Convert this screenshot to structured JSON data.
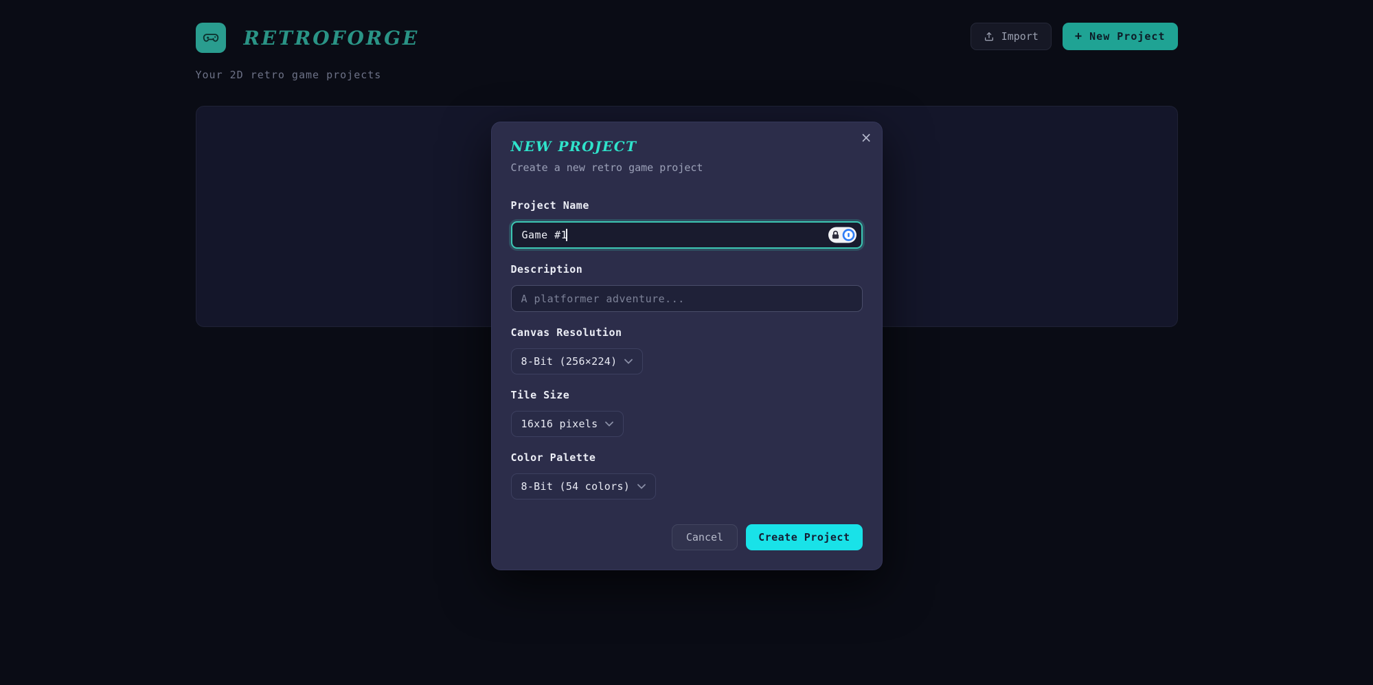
{
  "header": {
    "app_name": "RETROFORGE",
    "tagline": "Your 2D retro game projects",
    "import_label": "Import",
    "new_project_label": "New Project",
    "plus_glyph": "+"
  },
  "modal": {
    "title": "NEW PROJECT",
    "subtitle": "Create a new retro game project",
    "close_glyph": "×",
    "project_name": {
      "label": "Project Name",
      "value": "Game #1"
    },
    "description": {
      "label": "Description",
      "placeholder": "A platformer adventure..."
    },
    "canvas_resolution": {
      "label": "Canvas Resolution",
      "value": "8-Bit (256×224)"
    },
    "tile_size": {
      "label": "Tile Size",
      "value": "16x16 pixels"
    },
    "color_palette": {
      "label": "Color Palette",
      "value": "8-Bit (54 colors)"
    },
    "cancel_label": "Cancel",
    "create_label": "Create Project"
  },
  "colors": {
    "page_background": "#0a0c15",
    "panel_background": "#14162a",
    "modal_background": "#2c2d4a",
    "brand_teal": "#2a9d8f",
    "modal_title_cyan": "#2fe3cb",
    "create_button_cyan": "#19e2e8",
    "focus_ring_teal": "#3cc8b4",
    "onepassword_blue": "#2f7df6"
  },
  "icons": {
    "logo": "gamepad-icon",
    "import": "upload-icon",
    "new_project": "plus-icon",
    "close": "close-icon",
    "selects": "chevron-down-icon",
    "autofill_badge": "lock-icon + onepassword-icon"
  }
}
